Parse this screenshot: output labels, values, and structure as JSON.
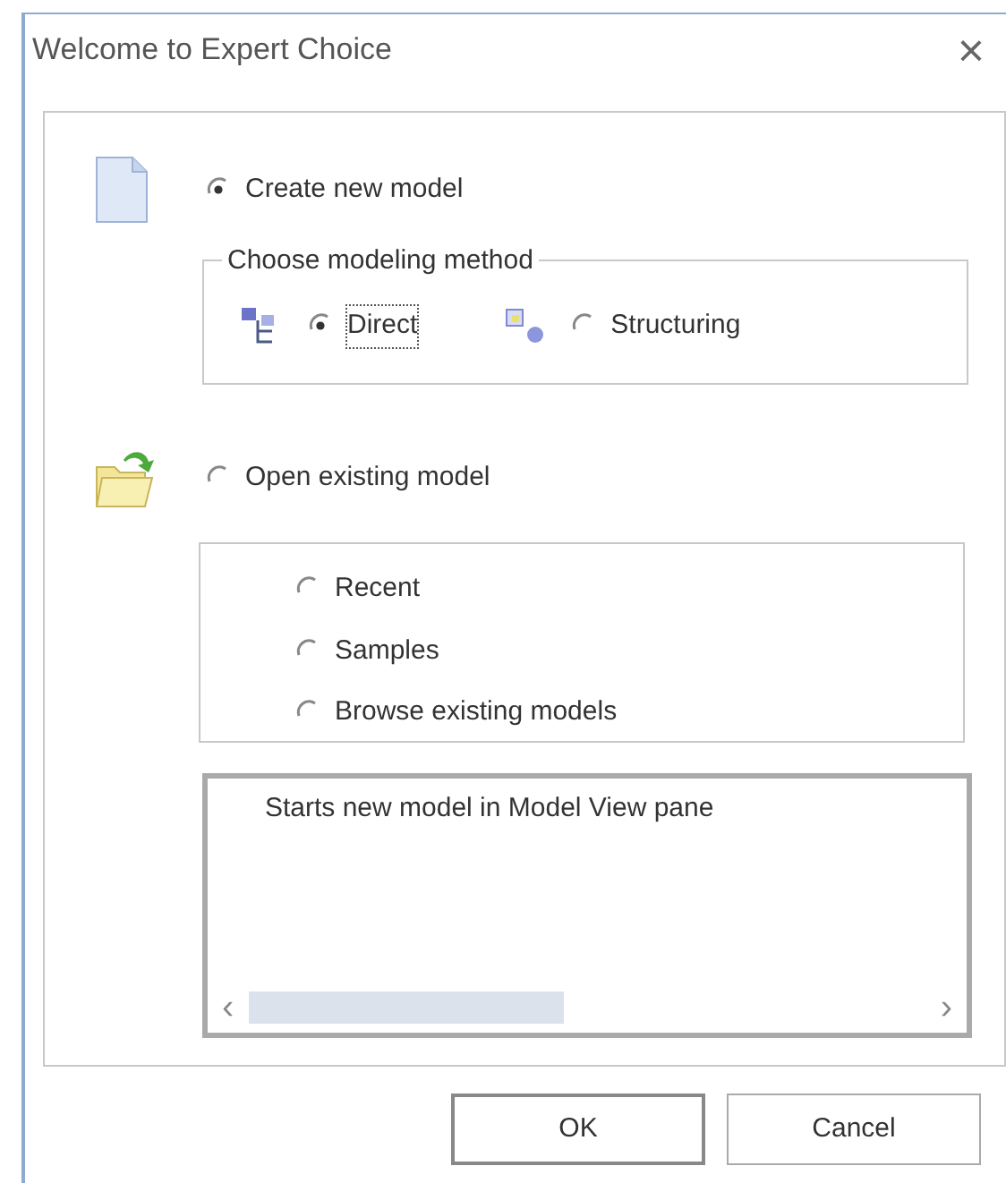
{
  "window": {
    "title": "Welcome to Expert Choice",
    "close": "×"
  },
  "create": {
    "label": "Create new model",
    "selected": true,
    "group_title": "Choose modeling method",
    "methods": [
      {
        "label": "Direct",
        "selected": true,
        "focused": true
      },
      {
        "label": "Structuring",
        "selected": false,
        "focused": false
      }
    ]
  },
  "open": {
    "label": "Open existing model",
    "selected": false,
    "options": [
      {
        "label": "Recent",
        "selected": false
      },
      {
        "label": "Samples",
        "selected": false
      },
      {
        "label": "Browse existing models",
        "selected": false
      }
    ]
  },
  "description": {
    "text": "Starts new model in Model View pane",
    "scroll_left": "‹",
    "scroll_right": "›"
  },
  "buttons": [
    {
      "label": "OK",
      "kind": "default"
    },
    {
      "label": "Cancel",
      "kind": "normal"
    }
  ]
}
